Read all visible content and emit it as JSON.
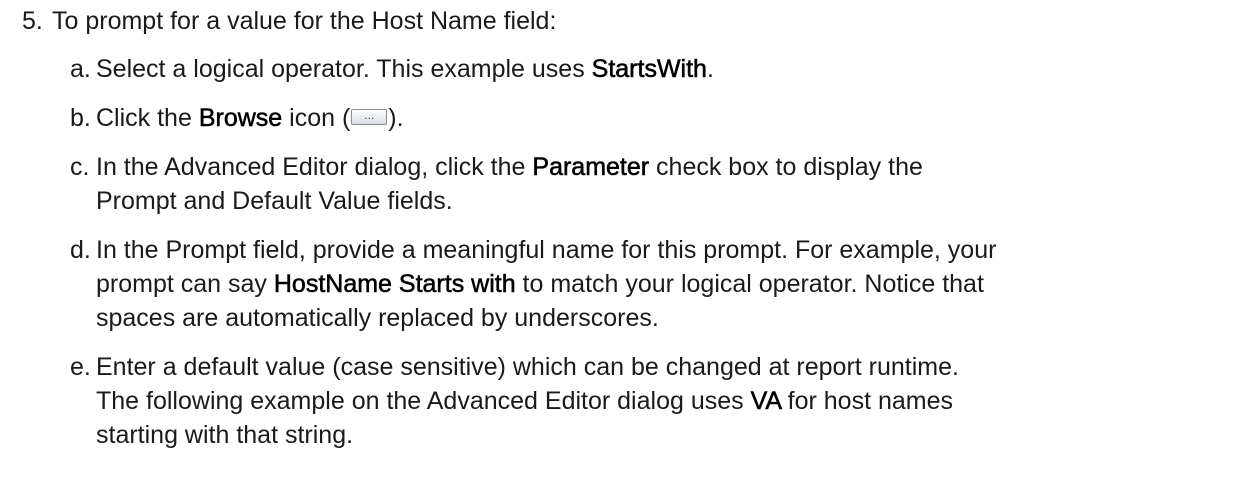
{
  "step": {
    "number": "5.",
    "text": "To prompt for a value for the Host Name field:"
  },
  "substeps": {
    "a": {
      "letter": "a.",
      "pre": "Select a logical operator. This example uses ",
      "ui": "StartsWith",
      "post": "."
    },
    "b": {
      "letter": "b.",
      "pre": "Click the ",
      "ui": "Browse",
      "mid": " icon (",
      "icon": "browse-button-icon",
      "icon_glyph": "...",
      "post": ")."
    },
    "c": {
      "letter": "c.",
      "pre": "In the Advanced Editor dialog, click the ",
      "ui": "Parameter",
      "post": " check box to display the",
      "line2": "Prompt and Default Value fields."
    },
    "d": {
      "letter": "d.",
      "line1": "In the Prompt field, provide a meaningful name for this prompt. For example, your",
      "pre2": "prompt can say ",
      "ui": "HostName Starts with",
      "post2": " to match your logical operator. Notice that",
      "line3": "spaces are automatically replaced by underscores."
    },
    "e": {
      "letter": "e.",
      "line1": "Enter a default value (case sensitive) which can be changed at report runtime.",
      "pre2": "The following example on the Advanced Editor dialog uses ",
      "ui": "VA",
      "post2": " for host names",
      "line3": "starting with that string."
    }
  }
}
